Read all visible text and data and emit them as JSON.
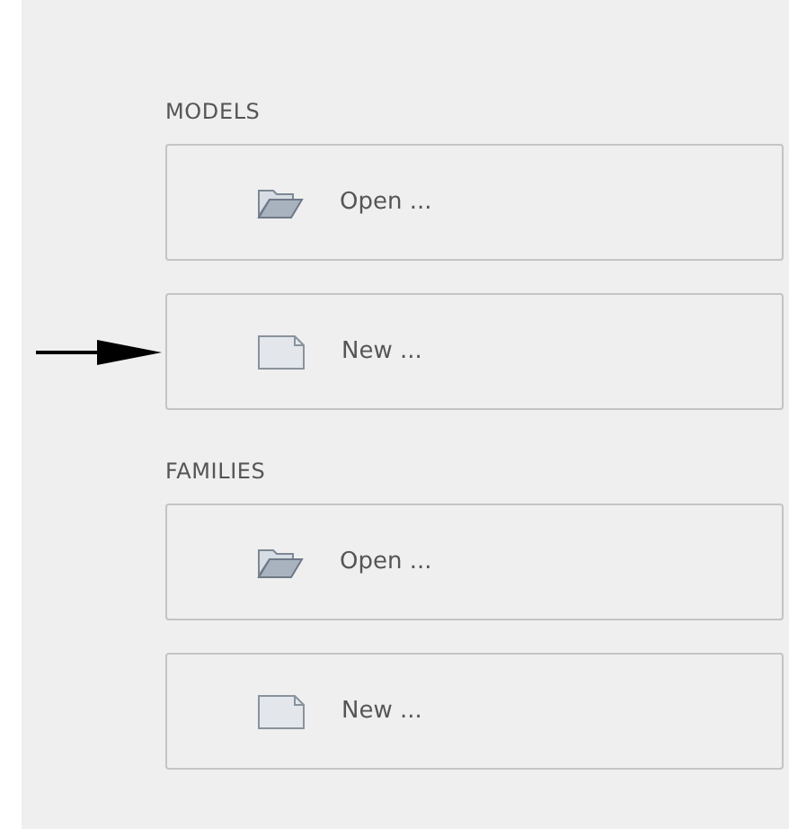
{
  "sections": [
    {
      "heading": "MODELS",
      "buttons": [
        {
          "kind": "open",
          "label": "Open ...",
          "arrow": false
        },
        {
          "kind": "new",
          "label": "New ...",
          "arrow": true
        }
      ]
    },
    {
      "heading": "FAMILIES",
      "buttons": [
        {
          "kind": "open",
          "label": "Open ...",
          "arrow": false
        },
        {
          "kind": "new",
          "label": "New ...",
          "arrow": false
        }
      ]
    }
  ]
}
